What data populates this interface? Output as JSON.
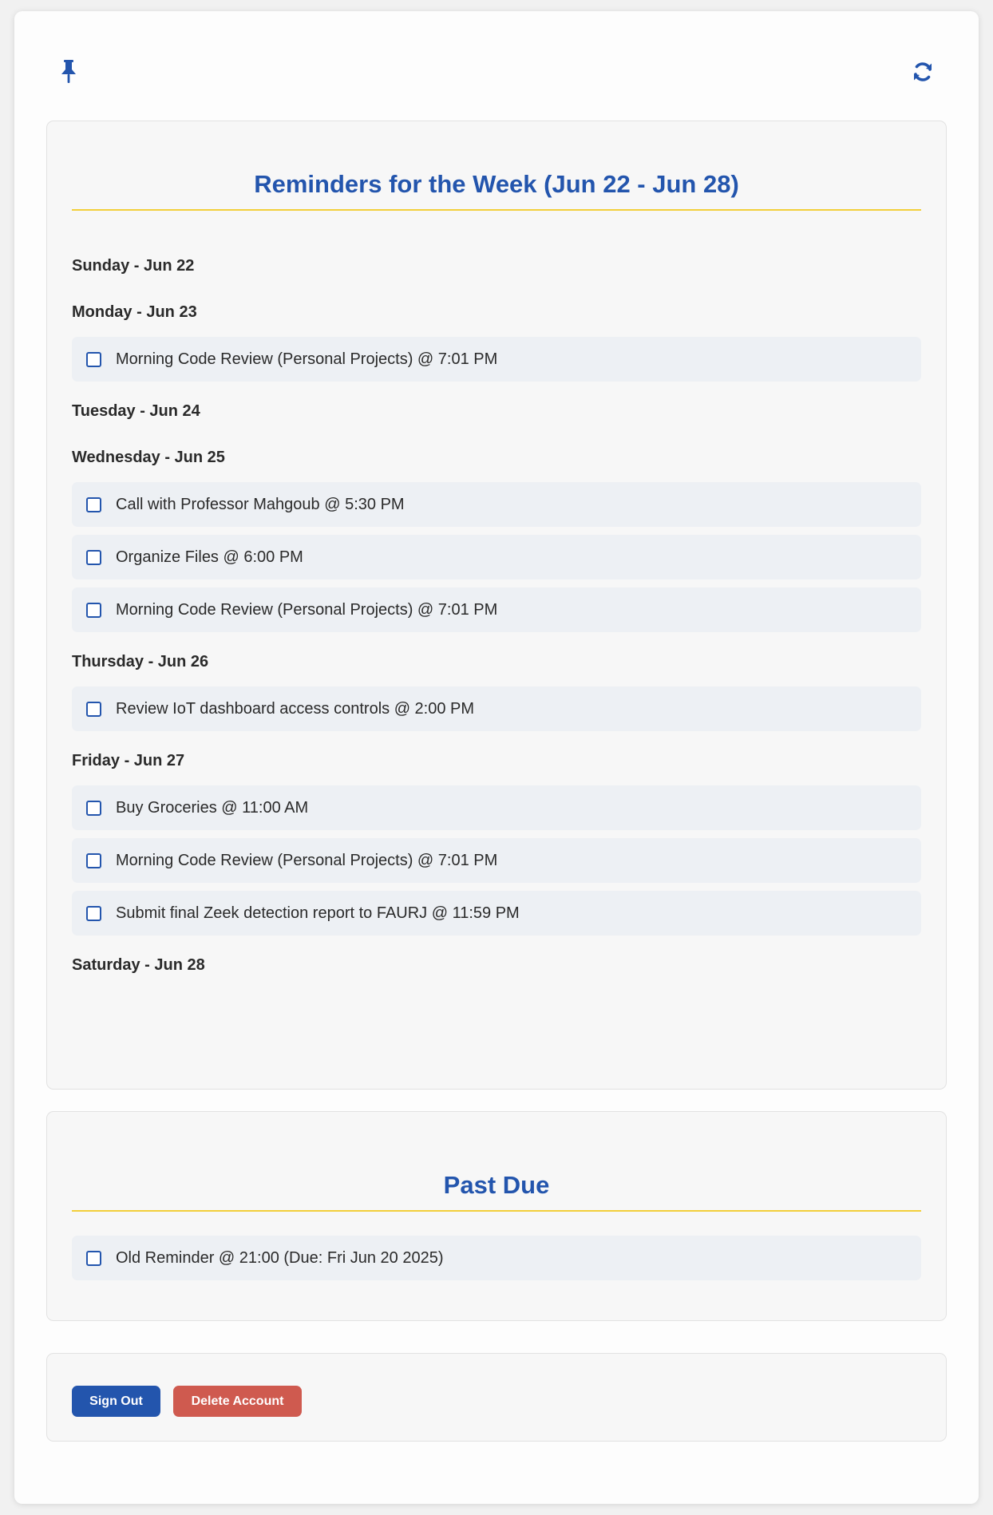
{
  "colors": {
    "accent": "#2355ad",
    "divider": "#f2cf3a",
    "danger": "#cf5a4f",
    "item_background": "#edf0f4"
  },
  "toolbar": {
    "pin_icon": "pin-icon",
    "refresh_icon": "refresh-icon"
  },
  "week": {
    "title": "Reminders for the Week (Jun 22 - Jun 28)",
    "days": [
      {
        "label": "Sunday - Jun 22",
        "reminders": []
      },
      {
        "label": "Monday - Jun 23",
        "reminders": [
          {
            "text": "Morning Code Review (Personal Projects) @ 7:01 PM",
            "checked": false
          }
        ]
      },
      {
        "label": "Tuesday - Jun 24",
        "reminders": []
      },
      {
        "label": "Wednesday - Jun 25",
        "reminders": [
          {
            "text": "Call with Professor Mahgoub @ 5:30 PM",
            "checked": false
          },
          {
            "text": "Organize Files @ 6:00 PM",
            "checked": false
          },
          {
            "text": "Morning Code Review (Personal Projects) @ 7:01 PM",
            "checked": false
          }
        ]
      },
      {
        "label": "Thursday - Jun 26",
        "reminders": [
          {
            "text": "Review IoT dashboard access controls @ 2:00 PM",
            "checked": false
          }
        ]
      },
      {
        "label": "Friday - Jun 27",
        "reminders": [
          {
            "text": "Buy Groceries @ 11:00 AM",
            "checked": false
          },
          {
            "text": "Morning Code Review (Personal Projects) @ 7:01 PM",
            "checked": false
          },
          {
            "text": "Submit final Zeek detection report to FAURJ @ 11:59 PM",
            "checked": false
          }
        ]
      },
      {
        "label": "Saturday - Jun 28",
        "reminders": []
      }
    ]
  },
  "past_due": {
    "title": "Past Due",
    "reminders": [
      {
        "text": "Old Reminder @ 21:00 (Due: Fri Jun 20 2025)",
        "checked": false
      }
    ]
  },
  "actions": {
    "sign_out_label": "Sign Out",
    "delete_account_label": "Delete Account"
  }
}
